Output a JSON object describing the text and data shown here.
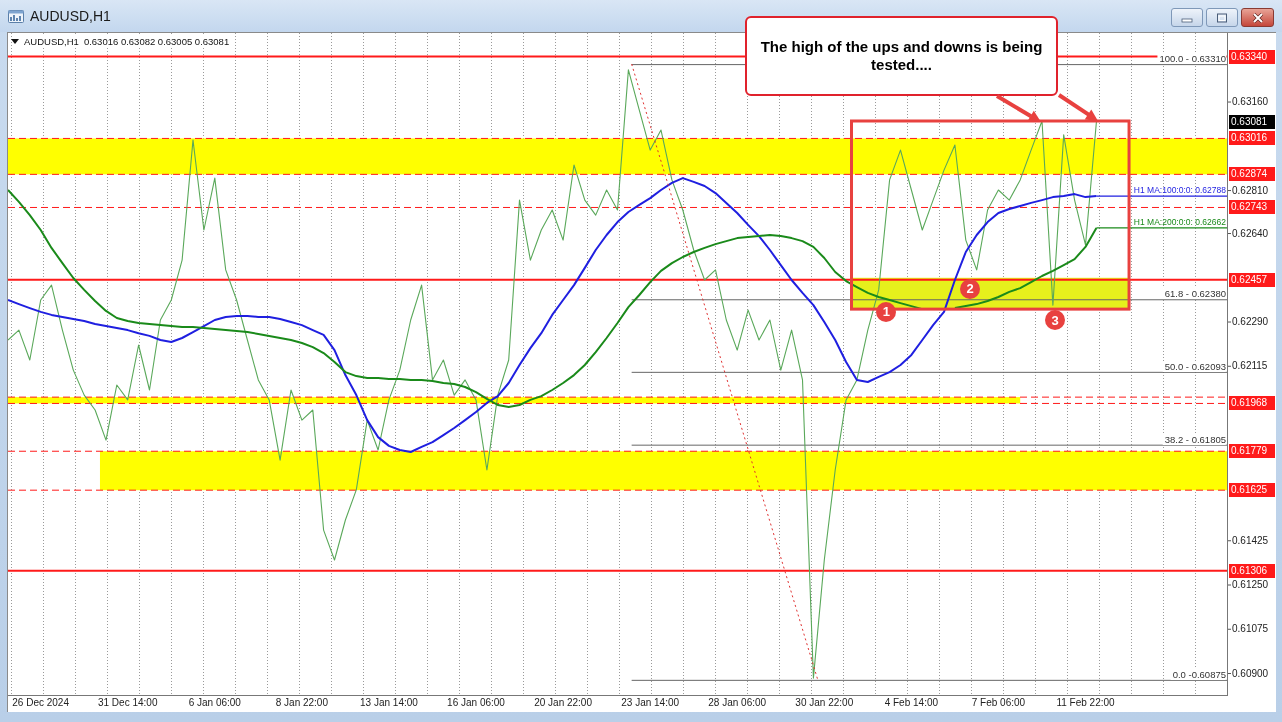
{
  "window": {
    "title": "AUDUSD,H1",
    "controls": [
      {
        "kind": "minimize"
      },
      {
        "kind": "maximize"
      },
      {
        "kind": "close"
      }
    ]
  },
  "chart": {
    "quote": "0.63016 0.63082 0.63005 0.63081",
    "markers": [
      "1",
      "2",
      "3"
    ],
    "chart_data": {
      "type": "line",
      "title": "AUDUSD,H1",
      "categories": [
        null,
        null,
        null,
        "26 Dec 2024",
        null,
        null,
        null,
        null,
        null,
        null,
        null,
        "31 Dec 14:00",
        null,
        null,
        null,
        null,
        null,
        null,
        null,
        "6 Jan 06:00",
        null,
        null,
        null,
        null,
        null,
        null,
        null,
        "8 Jan 22:00",
        null,
        null,
        null,
        null,
        null,
        null,
        null,
        "13 Jan 14:00",
        null,
        null,
        null,
        null,
        null,
        null,
        null,
        "16 Jan 06:00",
        null,
        null,
        null,
        null,
        null,
        null,
        null,
        "20 Jan 22:00",
        null,
        null,
        null,
        null,
        null,
        null,
        null,
        "23 Jan 14:00",
        null,
        null,
        null,
        null,
        null,
        null,
        null,
        "28 Jan 06:00",
        null,
        null,
        null,
        null,
        null,
        null,
        null,
        "30 Jan 22:00",
        null,
        null,
        null,
        null,
        null,
        null,
        null,
        "4 Feb 14:00",
        null,
        null,
        null,
        null,
        null,
        null,
        null,
        "7 Feb 06:00",
        null,
        null,
        null,
        null,
        null,
        null,
        null,
        "11 Feb 22:00",
        null,
        null,
        null,
        null,
        null,
        null,
        null,
        null,
        null,
        null,
        null,
        null
      ],
      "ylim": [
        0.60815,
        0.63433
      ],
      "yticks": [
        {
          "value": 0.6316,
          "label": "0.63160"
        },
        {
          "value": 0.6281,
          "label": "0.62810"
        },
        {
          "value": 0.6264,
          "label": "0.62640"
        },
        {
          "value": 0.6229,
          "label": "0.62290"
        },
        {
          "value": 0.62115,
          "label": "0.62115"
        },
        {
          "value": 0.61425,
          "label": "0.61425"
        },
        {
          "value": 0.6125,
          "label": "0.61250"
        },
        {
          "value": 0.61075,
          "label": "0.61075"
        },
        {
          "value": 0.609,
          "label": "0.60900"
        }
      ],
      "series": [
        {
          "color": "#5aa85a",
          "values": [
            0.62219,
            0.62258,
            0.6214,
            0.62377,
            0.62436,
            0.62258,
            0.621,
            0.62001,
            0.61942,
            0.61823,
            0.62041,
            0.61982,
            0.62199,
            0.62021,
            0.62298,
            0.62377,
            0.62535,
            0.6301,
            0.62654,
            0.62859,
            0.62496,
            0.62377,
            0.62219,
            0.62061,
            0.61982,
            0.61744,
            0.62021,
            0.61902,
            0.61942,
            0.61467,
            0.61349,
            0.61507,
            0.61626,
            0.61902,
            0.61784,
            0.61982,
            0.621,
            0.62298,
            0.62436,
            0.62061,
            0.6214,
            0.62001,
            0.62061,
            0.61982,
            0.61705,
            0.62001,
            0.6214,
            0.62772,
            0.62535,
            0.62654,
            0.62733,
            0.62614,
            0.62911,
            0.62772,
            0.62713,
            0.62812,
            0.62733,
            0.63287,
            0.63128,
            0.6297,
            0.63049,
            0.62852,
            0.62733,
            0.62575,
            0.62456,
            0.62496,
            0.62298,
            0.62179,
            0.62337,
            0.62219,
            0.62298,
            0.621,
            0.62258,
            0.62061,
            0.60882,
            0.61349,
            0.61705,
            0.61982,
            0.62061,
            0.62258,
            0.62417,
            0.62852,
            0.6297,
            0.62812,
            0.62654,
            0.62772,
            0.62891,
            0.6299,
            0.62614,
            0.62496,
            0.62733,
            0.62812,
            0.62772,
            0.62852,
            0.6297,
            0.63085,
            0.62357,
            0.6303,
            0.62772,
            0.62595,
            0.63081,
            null,
            null,
            null,
            null,
            null,
            null,
            null,
            null,
            null,
            null,
            null
          ]
        },
        {
          "name": "H1 MA:100:0:0: 0.62788",
          "color": "#1f1fe0",
          "values": [
            0.62377,
            0.62361,
            0.62345,
            0.6233,
            0.62318,
            0.6231,
            0.62302,
            0.62294,
            0.62282,
            0.62274,
            0.62266,
            0.62258,
            0.62246,
            0.62235,
            0.62219,
            0.62211,
            0.62227,
            0.6225,
            0.62274,
            0.62298,
            0.6231,
            0.62314,
            0.62314,
            0.6231,
            0.6231,
            0.62302,
            0.6229,
            0.62278,
            0.62258,
            0.62239,
            0.62179,
            0.6208,
            0.62001,
            0.61902,
            0.61835,
            0.618,
            0.61784,
            0.61776,
            0.61796,
            0.61815,
            0.61843,
            0.61871,
            0.61902,
            0.61934,
            0.6197,
            0.61997,
            0.62049,
            0.6212,
            0.62187,
            0.62246,
            0.62318,
            0.62377,
            0.62436,
            0.62504,
            0.62575,
            0.62634,
            0.62685,
            0.62725,
            0.62753,
            0.6278,
            0.62812,
            0.6284,
            0.62859,
            0.62844,
            0.62828,
            0.628,
            0.62761,
            0.62721,
            0.62674,
            0.6263,
            0.62575,
            0.62515,
            0.62456,
            0.62405,
            0.62357,
            0.6229,
            0.62219,
            0.62132,
            0.62061,
            0.62053,
            0.62073,
            0.62092,
            0.6212,
            0.6216,
            0.62219,
            0.62278,
            0.6233,
            0.62456,
            0.62567,
            0.62634,
            0.62685,
            0.62721,
            0.62737,
            0.62749,
            0.62761,
            0.62772,
            0.62784,
            0.62788,
            0.62796,
            0.62784,
            0.62788,
            null,
            null,
            null,
            null,
            null,
            null,
            null,
            null,
            null,
            null,
            null
          ]
        },
        {
          "name": "H1 MA:200:0:0: 0.62662",
          "color": "#1a8a1a",
          "values": [
            0.62812,
            0.62765,
            0.62713,
            0.62654,
            0.62583,
            0.62523,
            0.62464,
            0.62417,
            0.62373,
            0.62334,
            0.62306,
            0.62294,
            0.62286,
            0.62282,
            0.62278,
            0.62274,
            0.6227,
            0.6227,
            0.62266,
            0.62262,
            0.62258,
            0.62254,
            0.6225,
            0.62243,
            0.62235,
            0.62227,
            0.62219,
            0.62207,
            0.62191,
            0.62167,
            0.62132,
            0.62092,
            0.62076,
            0.62069,
            0.62069,
            0.62065,
            0.62065,
            0.62061,
            0.62061,
            0.62057,
            0.62049,
            0.62045,
            0.62033,
            0.62013,
            0.61986,
            0.61962,
            0.61954,
            0.61962,
            0.61982,
            0.61997,
            0.62021,
            0.62049,
            0.6208,
            0.6212,
            0.62171,
            0.62227,
            0.62286,
            0.62349,
            0.62397,
            0.62448,
            0.62492,
            0.62523,
            0.62547,
            0.62567,
            0.62583,
            0.62598,
            0.6261,
            0.62622,
            0.62626,
            0.6263,
            0.62634,
            0.6263,
            0.62622,
            0.6261,
            0.62587,
            0.62543,
            0.62488,
            0.62452,
            0.62428,
            0.62405,
            0.62389,
            0.62377,
            0.62365,
            0.62353,
            0.62341,
            null,
            null,
            0.62345,
            0.62353,
            0.62361,
            0.62373,
            0.62389,
            0.62409,
            0.62424,
            0.62448,
            0.62472,
            0.62492,
            0.62515,
            0.62539,
            0.62587,
            0.62662,
            null,
            null,
            null,
            null,
            null,
            null,
            null,
            null,
            null,
            null,
            null
          ]
        }
      ],
      "bands": [
        {
          "axis": "y",
          "from": 0.62874,
          "to": 0.63016,
          "color": "#ffff00"
        },
        {
          "axis": "y",
          "from": 0.61968,
          "to": 0.61993,
          "color": "#ffff00"
        },
        {
          "axis": "y",
          "from": 0.61625,
          "to": 0.61779,
          "color": "#ffff00"
        },
        {
          "axis": "y",
          "from": 0.62345,
          "to": 0.62465,
          "color": "#e6f01c"
        }
      ],
      "ref_lines": [
        {
          "axis": "y",
          "value": 0.6334,
          "label": "0.63340"
        },
        {
          "axis": "y",
          "value": 0.63016,
          "label": "0.63016"
        },
        {
          "axis": "y",
          "value": 0.62874,
          "label": "0.62874"
        },
        {
          "axis": "y",
          "value": 0.62743,
          "label": "0.62743"
        },
        {
          "axis": "y",
          "value": 0.62457,
          "label": "0.62457"
        },
        {
          "axis": "y",
          "value": 0.61993
        },
        {
          "axis": "y",
          "value": 0.61968,
          "label": "0.61968"
        },
        {
          "axis": "y",
          "value": 0.61779,
          "label": "0.61779"
        },
        {
          "axis": "y",
          "value": 0.61625,
          "label": "0.61625"
        },
        {
          "axis": "y",
          "value": 0.61306,
          "label": "0.61306"
        },
        {
          "axis": "y",
          "value": 0.6331
        },
        {
          "axis": "y",
          "value": 0.6238
        },
        {
          "axis": "y",
          "value": 0.62093
        },
        {
          "axis": "y",
          "value": 0.61805
        },
        {
          "axis": "y",
          "value": 0.60875
        }
      ],
      "annotations": [
        "0.63081",
        {
          "text": "100.0 - 0.63310",
          "y": 0.6331
        },
        {
          "text": "61.8 - 0.62380",
          "y": 0.6238
        },
        {
          "text": "50.0 - 0.62093",
          "y": 0.62093
        },
        {
          "text": "38.2 - 0.61805",
          "y": 0.61805
        },
        {
          "text": "0.0 -0.60875",
          "y": 0.60875
        }
      ]
    }
  },
  "callout": {
    "text": "The high of the ups and downs is being tested...."
  }
}
